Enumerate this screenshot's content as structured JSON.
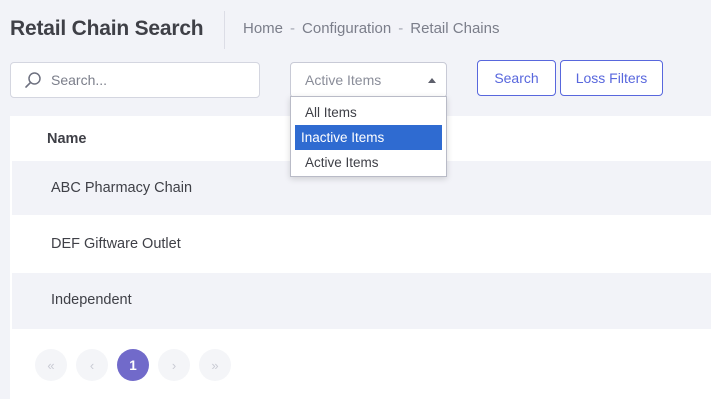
{
  "header": {
    "title": "Retail Chain Search",
    "breadcrumb": [
      "Home",
      "Configuration",
      "Retail Chains"
    ],
    "breadcrumb_sep": "-"
  },
  "filters": {
    "search_placeholder": "Search...",
    "status_select_value": "Active Items",
    "status_options": [
      "All Items",
      "Inactive Items",
      "Active Items"
    ],
    "highlighted_option": "Inactive Items"
  },
  "buttons": {
    "search_label": "Search",
    "loss_filters_label": "Loss Filters"
  },
  "table": {
    "column_name": "Name",
    "rows": [
      "ABC Pharmacy Chain",
      "DEF Giftware Outlet",
      "Independent"
    ]
  },
  "pagination": {
    "first": "«",
    "prev": "‹",
    "current_page": "1",
    "next": "›",
    "last": "»"
  },
  "colors": {
    "accent": "#5867dd",
    "page_active": "#716aca",
    "option_highlight": "#2f6bd1",
    "background": "#f2f3f8"
  }
}
